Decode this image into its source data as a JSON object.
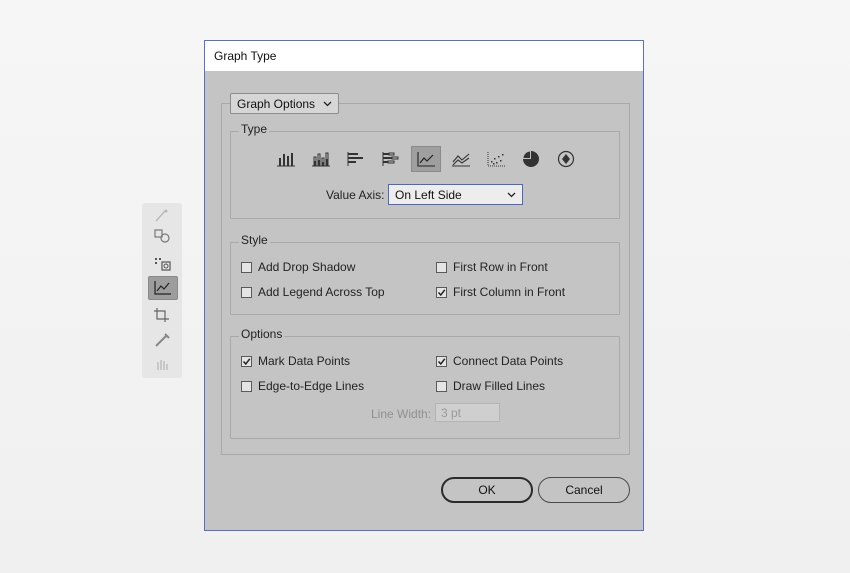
{
  "dialog": {
    "title": "Graph Type",
    "section_select": "Graph Options"
  },
  "type": {
    "label": "Type",
    "icons": [
      "column-graph-icon",
      "stacked-column-graph-icon",
      "bar-graph-icon",
      "stacked-bar-graph-icon",
      "line-graph-icon",
      "area-graph-icon",
      "scatter-graph-icon",
      "pie-graph-icon",
      "radar-graph-icon"
    ],
    "selected": "line-graph-icon",
    "value_axis_label": "Value Axis:",
    "value_axis_value": "On Left Side"
  },
  "style": {
    "label": "Style",
    "add_drop_shadow": "Add Drop Shadow",
    "add_drop_shadow_checked": false,
    "add_legend": "Add Legend Across Top",
    "add_legend_checked": false,
    "first_row": "First Row in Front",
    "first_row_checked": false,
    "first_column": "First Column in Front",
    "first_column_checked": true
  },
  "options": {
    "label": "Options",
    "mark_points": "Mark Data Points",
    "mark_points_checked": true,
    "connect_points": "Connect Data Points",
    "connect_points_checked": true,
    "edge_lines": "Edge-to-Edge Lines",
    "edge_lines_checked": false,
    "filled_lines": "Draw Filled Lines",
    "filled_lines_checked": false,
    "line_width_label": "Line Width:",
    "line_width_value": "3 pt"
  },
  "buttons": {
    "ok": "OK",
    "cancel": "Cancel"
  },
  "toolbar": {
    "tools": [
      "symbol-sprayer-icon",
      "symbol-icon",
      "column-graph-tool-icon",
      "line-graph-tool-icon",
      "artboard-icon",
      "eyedropper-icon",
      "hand-icon"
    ]
  }
}
